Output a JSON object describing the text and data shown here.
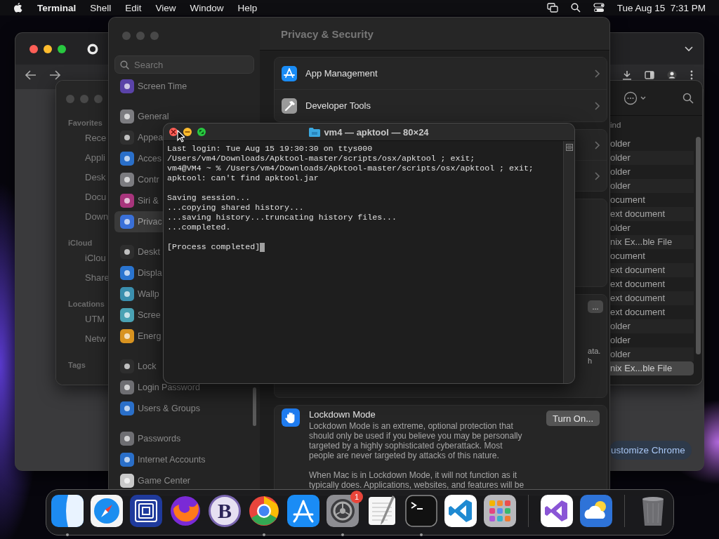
{
  "menu_bar": {
    "app": "Terminal",
    "menus": [
      "Shell",
      "Edit",
      "View",
      "Window",
      "Help"
    ],
    "clock": "Tue Aug 15  7:31 PM"
  },
  "browser_window": {
    "focused": true,
    "button": "ustomize Chrome"
  },
  "finder_window": {
    "focused": false,
    "sidebar": [
      {
        "heading": "Favorites",
        "items": [
          "Rece",
          "Appli",
          "Desk",
          "Docu",
          "Down"
        ]
      },
      {
        "heading": "iCloud",
        "items": [
          "iClou",
          "Share"
        ]
      },
      {
        "heading": "Locations",
        "items": [
          "UTM",
          "Netw"
        ]
      },
      {
        "heading": "Tags"
      }
    ],
    "column_header": "ind",
    "rows": [
      {
        "text": "older",
        "selected": false
      },
      {
        "text": "older",
        "selected": false
      },
      {
        "text": "older",
        "selected": false
      },
      {
        "text": "older",
        "selected": false
      },
      {
        "text": "ocument",
        "selected": false
      },
      {
        "text": "ext document",
        "selected": false
      },
      {
        "text": "older",
        "selected": false
      },
      {
        "text": "nix Ex...ble File",
        "selected": false
      },
      {
        "text": "ocument",
        "selected": false
      },
      {
        "text": "ext document",
        "selected": false
      },
      {
        "text": "ext document",
        "selected": false
      },
      {
        "text": "ext document",
        "selected": false
      },
      {
        "text": "ext document",
        "selected": false
      },
      {
        "text": "older",
        "selected": false
      },
      {
        "text": "older",
        "selected": false
      },
      {
        "text": "older",
        "selected": false
      },
      {
        "text": "nix Ex...ble File",
        "selected": true
      }
    ]
  },
  "settings_window": {
    "focused": false,
    "search": {
      "placeholder": "Search"
    },
    "sidebar_groups": [
      {
        "items": [
          {
            "label": "Screen Time",
            "color": "#5a43a8",
            "selected": false
          }
        ]
      },
      {
        "items": [
          {
            "label": "General",
            "color": "#7c7c80",
            "selected": false
          },
          {
            "label": "Appea",
            "color": "#303030",
            "selected": false
          },
          {
            "label": "Acces",
            "color": "#2a6fc9",
            "selected": false
          },
          {
            "label": "Contr",
            "color": "#7c7c80",
            "selected": false
          },
          {
            "label": "Siri &",
            "color": "#a8357c",
            "selected": false
          },
          {
            "label": "Privac",
            "color": "#3a70d8",
            "selected": true
          }
        ]
      },
      {
        "items": [
          {
            "label": "Deskt",
            "color": "#2e2e2e",
            "selected": false
          },
          {
            "label": "Displa",
            "color": "#2a74cf",
            "selected": false
          },
          {
            "label": "Wallp",
            "color": "#3b8fae",
            "selected": false
          },
          {
            "label": "Scree",
            "color": "#4aa2b4",
            "selected": false
          },
          {
            "label": "Energ",
            "color": "#d89320",
            "selected": false
          }
        ]
      },
      {
        "items": [
          {
            "label": "Lock",
            "color": "#2e2e2e",
            "selected": false
          },
          {
            "label": "Login Password",
            "color": "#6e6e72",
            "selected": false
          },
          {
            "label": "Users & Groups",
            "color": "#2a6fc9",
            "selected": false
          }
        ]
      },
      {
        "items": [
          {
            "label": "Passwords",
            "color": "#6e6e72",
            "selected": false
          },
          {
            "label": "Internet Accounts",
            "color": "#2a6fc9",
            "selected": false
          },
          {
            "label": "Game Center",
            "color": "#c9c9c9",
            "selected": false
          }
        ]
      }
    ],
    "title": "Privacy & Security",
    "rows": [
      "App Management",
      "Developer Tools"
    ],
    "more_button": "...",
    "fragments": [
      "ata.",
      "h"
    ],
    "lockdown": {
      "title": "Lockdown Mode",
      "button": "Turn On...",
      "paragraphs": [
        "Lockdown Mode is an extreme, optional protection that should only be used if you believe you may be personally targeted by a highly sophisticated cyberattack. Most people are never targeted by attacks of this nature.",
        "When Mac is in Lockdown Mode, it will not function as it typically does. Applications, websites, and features will be"
      ]
    }
  },
  "terminal_window": {
    "focused": true,
    "title": "vm4 — apktool — 80×24",
    "blocks": [
      [
        "Last login: Tue Aug 15 19:30:30 on ttys000",
        "/Users/vm4/Downloads/Apktool-master/scripts/osx/apktool ; exit;",
        "vm4@VM4 ~ % /Users/vm4/Downloads/Apktool-master/scripts/osx/apktool ; exit;",
        "apktool: can't find apktool.jar"
      ],
      [
        "Saving session...",
        "...copying shared history...",
        "...saving history...truncating history files...",
        "...completed."
      ],
      [
        "[Process completed]"
      ]
    ]
  },
  "dock": {
    "sections": [
      {
        "items": [
          {
            "running": true
          },
          {
            "running": false
          },
          {
            "running": false
          },
          {
            "running": false
          },
          {
            "running": false,
            "label": "B"
          },
          {
            "running": true
          },
          {
            "running": false
          },
          {
            "running": true,
            "badge": "1"
          },
          {
            "running": false
          },
          {
            "running": true
          },
          {
            "running": false
          },
          {
            "running": false
          }
        ]
      },
      {
        "items": [
          {
            "running": false
          },
          {
            "running": false
          }
        ]
      },
      {
        "items": [
          {
            "running": false
          }
        ]
      }
    ]
  }
}
